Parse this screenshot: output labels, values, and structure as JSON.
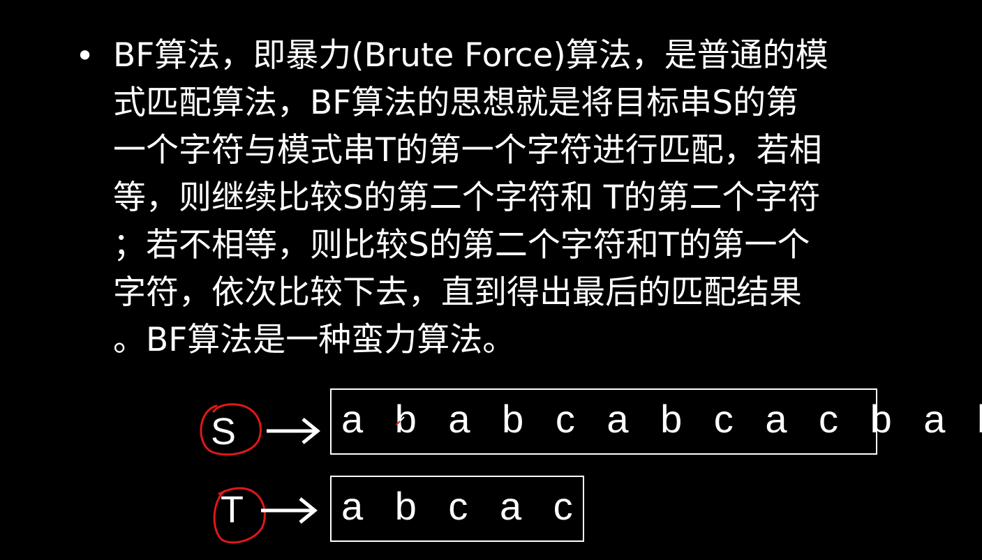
{
  "slide": {
    "bullet": "•",
    "lines": [
      "BF算法，即暴力(Brute Force)算法，是普通的模",
      "式匹配算法，BF算法的思想就是将目标串S的第",
      "一个字符与模式串T的第一个字符进行匹配，若相",
      "等，则继续比较S的第二个字符和 T的第二个字符",
      "；若不相等，则比较S的第二个字符和T的第一个",
      "字符，依次比较下去，直到得出最后的匹配结果",
      "。BF算法是一种蛮力算法。"
    ]
  },
  "diagram": {
    "s_label": "S",
    "t_label": "T",
    "s_string": "a b a b c a b c a c b a b",
    "t_string": "a b c a c"
  },
  "colors": {
    "background": "#000000",
    "text": "#ffffff",
    "annotation": "#e01818"
  }
}
